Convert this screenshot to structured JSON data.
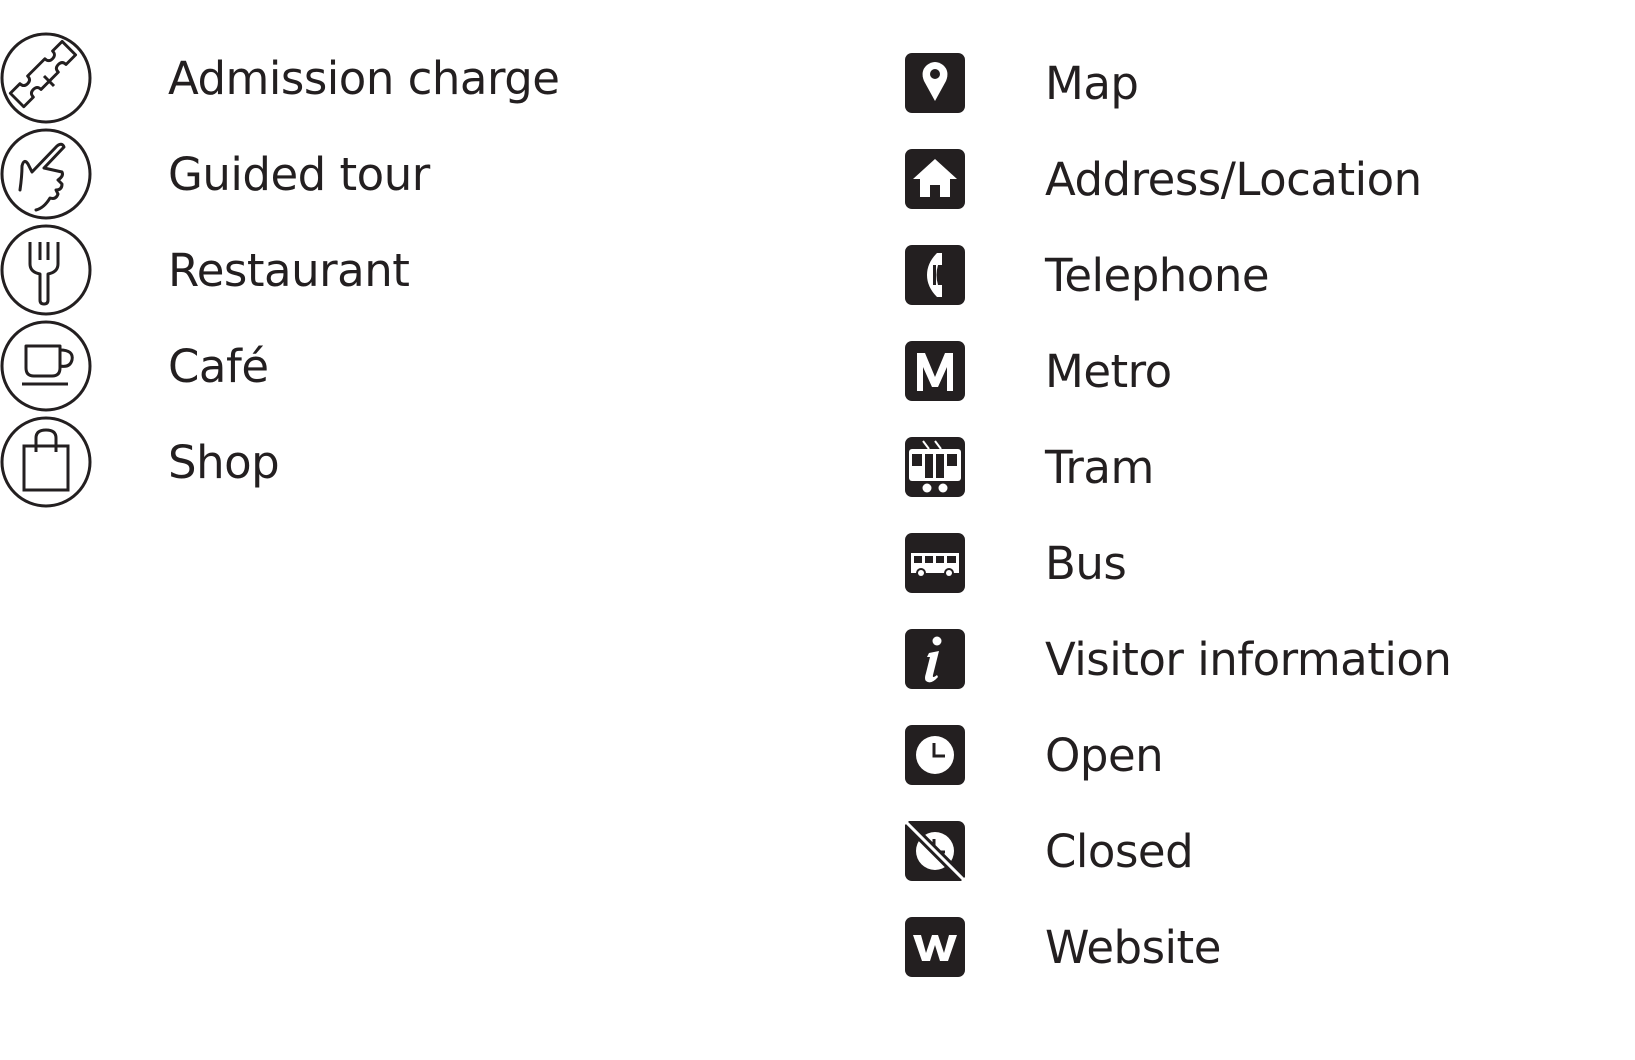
{
  "colors": {
    "ink": "#231f20",
    "background": "#ffffff"
  },
  "left_legend": [
    {
      "icon": "ticket-icon",
      "label": "Admission charge"
    },
    {
      "icon": "pointing-hand-icon",
      "label": "Guided tour"
    },
    {
      "icon": "fork-icon",
      "label": "Restaurant"
    },
    {
      "icon": "coffee-cup-icon",
      "label": "Café"
    },
    {
      "icon": "shopping-bag-icon",
      "label": "Shop"
    }
  ],
  "right_legend": [
    {
      "icon": "map-pin-icon",
      "label": "Map"
    },
    {
      "icon": "house-icon",
      "label": "Address/Location"
    },
    {
      "icon": "telephone-icon",
      "label": "Telephone"
    },
    {
      "icon": "metro-icon",
      "label": "Metro"
    },
    {
      "icon": "tram-icon",
      "label": "Tram"
    },
    {
      "icon": "bus-icon",
      "label": "Bus"
    },
    {
      "icon": "info-icon",
      "label": "Visitor information"
    },
    {
      "icon": "clock-icon",
      "label": "Open"
    },
    {
      "icon": "clock-crossed-icon",
      "label": "Closed"
    },
    {
      "icon": "website-icon",
      "label": "Website"
    }
  ]
}
